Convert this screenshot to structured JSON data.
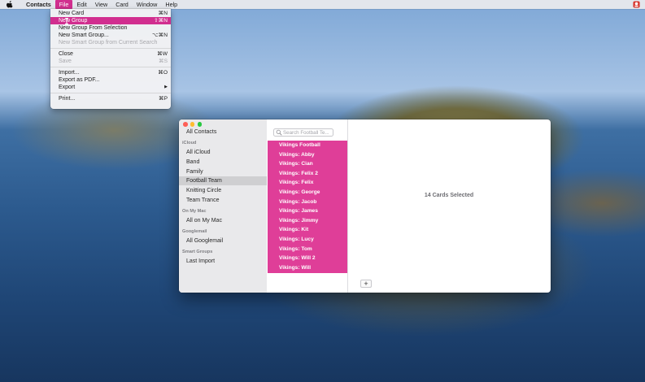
{
  "menubar": {
    "app_name": "Contacts",
    "menus": [
      "File",
      "Edit",
      "View",
      "Card",
      "Window",
      "Help"
    ],
    "active_menu": "File"
  },
  "file_menu": {
    "items": [
      {
        "label": "New Card",
        "shortcut": "⌘N"
      },
      {
        "label": "New Group",
        "shortcut": "⇧⌘N",
        "highlighted": true
      },
      {
        "label": "New Group From Selection",
        "shortcut": ""
      },
      {
        "label": "New Smart Group...",
        "shortcut": "⌥⌘N"
      },
      {
        "label": "New Smart Group from Current Search",
        "shortcut": "",
        "disabled": true
      },
      {
        "label": "Close",
        "shortcut": "⌘W"
      },
      {
        "label": "Save",
        "shortcut": "⌘S",
        "disabled": true
      },
      {
        "label": "Import...",
        "shortcut": "⌘O"
      },
      {
        "label": "Export as PDF...",
        "shortcut": ""
      },
      {
        "label": "Export",
        "shortcut": "▶"
      },
      {
        "label": "Print...",
        "shortcut": "⌘P"
      }
    ]
  },
  "sidebar": {
    "all_contacts": "All Contacts",
    "sections": [
      {
        "header": "iCloud",
        "items": [
          "All iCloud",
          "Band",
          "Family",
          "Football Team",
          "Knitting Circle",
          "Team Trance"
        ]
      },
      {
        "header": "On My Mac",
        "items": [
          "All on My Mac"
        ]
      },
      {
        "header": "Googlemail",
        "items": [
          "All Googlemail"
        ]
      },
      {
        "header": "Smart Groups",
        "items": [
          "Last Import"
        ]
      }
    ],
    "selected": "Football Team"
  },
  "search": {
    "placeholder": "Search Football Te..."
  },
  "cards": [
    "Vikings Football",
    "Vikings: Abby",
    "Vikings: Cian",
    "Vikings: Felix 2",
    "Vikings: Felix",
    "Vikings: George",
    "Vikings: Jacob",
    "Vikings: James",
    "Vikings: Jimmy",
    "Vikings: Kit",
    "Vikings: Lucy",
    "Vikings: Tom",
    "Vikings: Will 2",
    "Vikings: Will"
  ],
  "detail": {
    "summary": "14 Cards Selected",
    "add_label": "+"
  },
  "colors": {
    "accent": "#d12e8f",
    "selection": "#df3e98"
  }
}
